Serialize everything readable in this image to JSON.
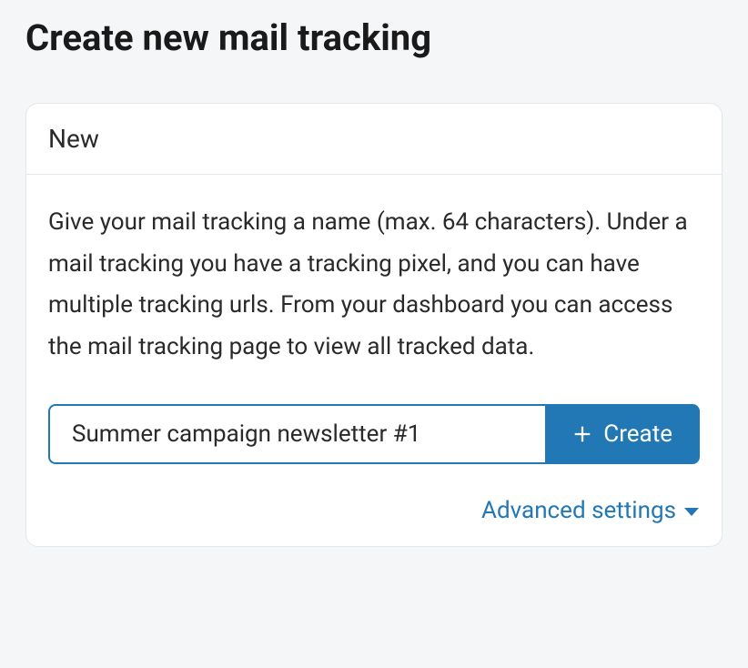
{
  "page": {
    "title": "Create new mail tracking"
  },
  "card": {
    "header": "New",
    "description": "Give your mail tracking a name (max. 64 characters). Under a mail tracking you have a tracking pixel, and you can have multiple tracking urls. From your dashboard you can access the mail tracking page to view all tracked data.",
    "input_value": "Summer campaign newsletter #1",
    "create_label": "Create",
    "advanced_label": "Advanced settings"
  }
}
